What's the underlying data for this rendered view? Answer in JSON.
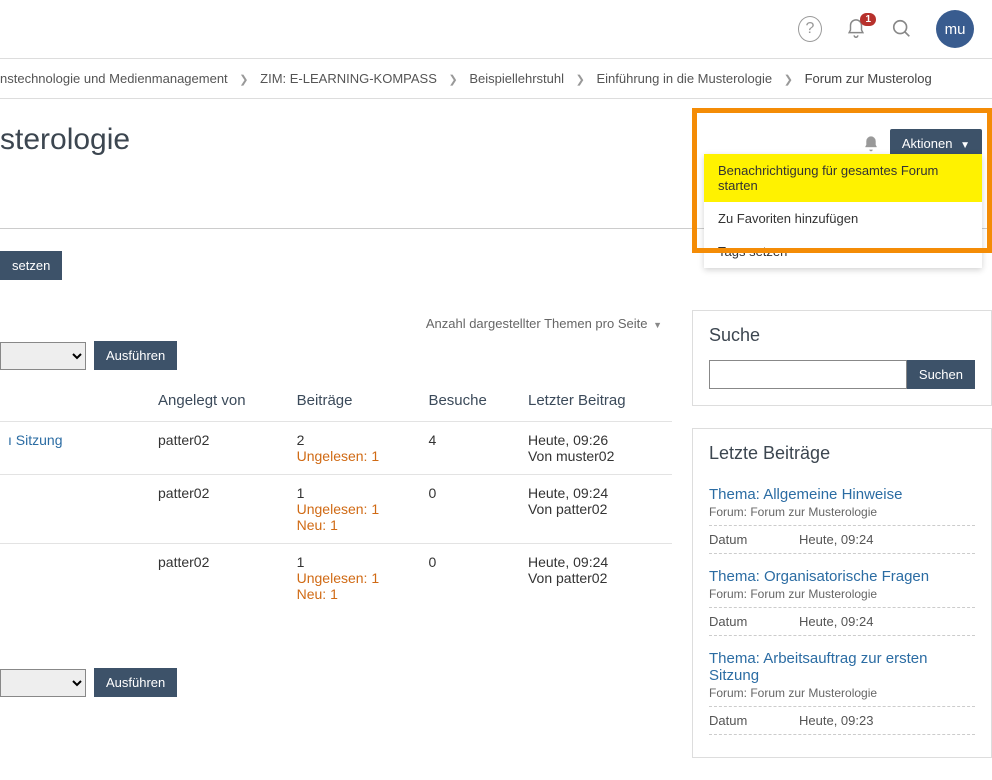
{
  "topbar": {
    "notification_count": "1",
    "avatar_text": "mu"
  },
  "breadcrumbs": {
    "items": [
      "nstechnologie und Medienmanagement",
      "ZIM: E-LEARNING-KOMPASS",
      "Beispiellehrstuhl",
      "Einführung in die Musterologie",
      "Forum zur Musterolog"
    ]
  },
  "page_title": "sterologie",
  "actions_button": "Aktionen",
  "actions_menu": {
    "items": [
      "Benachrichtigung für gesamtes Forum starten",
      "Zu Favoriten hinzufügen",
      "Tags setzen"
    ]
  },
  "setzen_label": "setzen",
  "perpage_label": "Anzahl dargestellter Themen pro Seite",
  "execute_label": "Ausführen",
  "table": {
    "headers": {
      "author": "Angelegt von",
      "posts": "Beiträge",
      "visits": "Besuche",
      "last": "Letzter Beitrag"
    },
    "rows": [
      {
        "title": "ı Sitzung",
        "author": "patter02",
        "posts": "2",
        "unread": "Ungelesen: 1",
        "new": "",
        "visits": "4",
        "last_date": "Heute, 09:26",
        "last_by": "Von muster02"
      },
      {
        "title": "",
        "author": "patter02",
        "posts": "1",
        "unread": "Ungelesen: 1",
        "new": "Neu: 1",
        "visits": "0",
        "last_date": "Heute, 09:24",
        "last_by": "Von patter02"
      },
      {
        "title": "",
        "author": "patter02",
        "posts": "1",
        "unread": "Ungelesen: 1",
        "new": "Neu: 1",
        "visits": "0",
        "last_date": "Heute, 09:24",
        "last_by": "Von patter02"
      }
    ]
  },
  "sidebar": {
    "search_title": "Suche",
    "search_button": "Suchen",
    "recent_title": "Letzte Beiträge",
    "date_label": "Datum",
    "recent": [
      {
        "title": "Thema: Allgemeine Hinweise",
        "forum": "Forum: Forum zur Musterologie",
        "date": "Heute, 09:24"
      },
      {
        "title": "Thema: Organisatorische Fragen",
        "forum": "Forum: Forum zur Musterologie",
        "date": "Heute, 09:24"
      },
      {
        "title": "Thema: Arbeitsauftrag zur ersten Sitzung",
        "forum": "Forum: Forum zur Musterologie",
        "date": "Heute, 09:23"
      }
    ]
  }
}
